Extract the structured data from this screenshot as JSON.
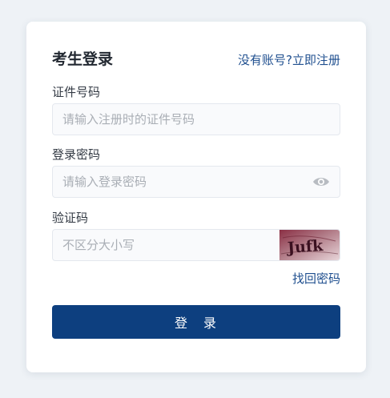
{
  "login": {
    "title": "考生登录",
    "register_link": "没有账号?立即注册",
    "id_label": "证件号码",
    "id_placeholder": "请输入注册时的证件号码",
    "password_label": "登录密码",
    "password_placeholder": "请输入登录密码",
    "captcha_label": "验证码",
    "captcha_placeholder": "不区分大小写",
    "captcha_text": "Jufk",
    "forgot_link": "找回密码",
    "submit_label": "登　录"
  },
  "colors": {
    "primary": "#0d3f7f",
    "link": "#1f4f8f",
    "captcha_bg": "#9a3b4e"
  },
  "icons": {
    "password_toggle": "eye-icon"
  }
}
